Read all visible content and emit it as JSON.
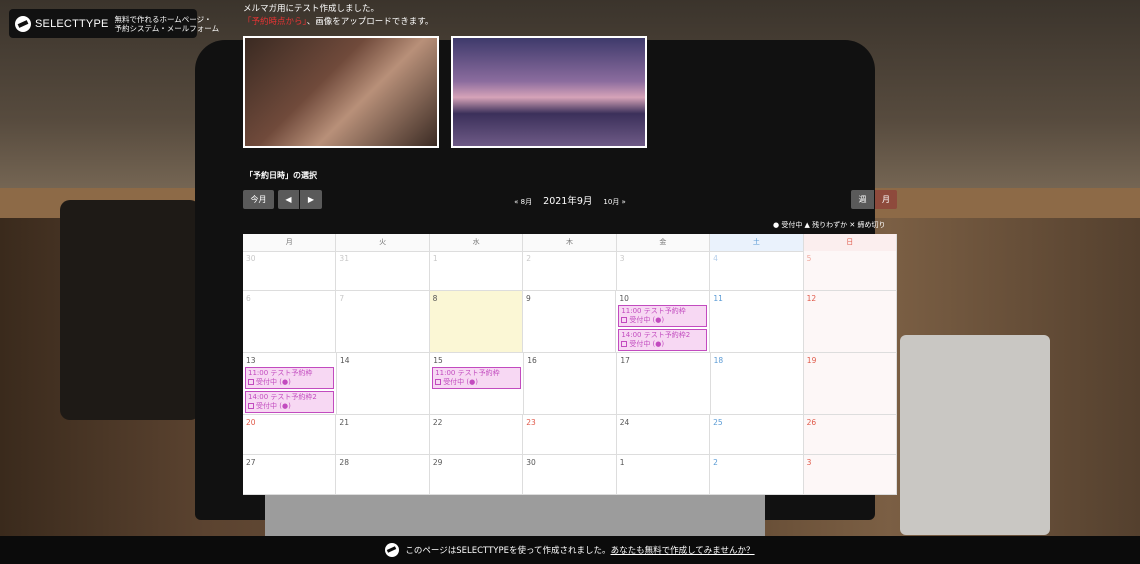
{
  "logo": {
    "name": "SELECTTYPE",
    "tagline_1": "無料で作れるホームページ・",
    "tagline_2": "予約システム・メールフォーム"
  },
  "intro": {
    "line1": "メルマガ用にテスト作成しました。",
    "line2_highlight": "「予約時点から」",
    "line2_rest": "、画像をアップロードできます。"
  },
  "section_title": "「予約日時」の選択",
  "toolbar": {
    "today": "今月",
    "prev_icon": "◀",
    "next_icon": "▶",
    "prev_month": "« 8月",
    "current_month": "2021年9月",
    "next_month": "10月 »",
    "week": "週",
    "month": "月"
  },
  "legend": "● 受付中 ▲ 残りわずか ✕ 締め切り",
  "weekdays": [
    "月",
    "火",
    "水",
    "木",
    "金",
    "土",
    "日"
  ],
  "weeks": [
    [
      "30",
      "31",
      "1",
      "2",
      "3",
      "4",
      "5"
    ],
    [
      "6",
      "7",
      "8",
      "9",
      "10",
      "11",
      "12"
    ],
    [
      "13",
      "14",
      "15",
      "16",
      "17",
      "18",
      "19"
    ],
    [
      "20",
      "21",
      "22",
      "23",
      "24",
      "25",
      "26"
    ],
    [
      "27",
      "28",
      "29",
      "30",
      "1",
      "2",
      "3"
    ]
  ],
  "events": {
    "e1_title": "11:00 テスト予約枠",
    "e1_status": "受付中 (●)",
    "e2_title": "14:00 テスト予約枠2",
    "e2_status": "受付中 (●)"
  },
  "footer": {
    "text": "このページはSELECTTYPEを使って作成されました。",
    "link": "あなたも無料で作成してみませんか？"
  }
}
